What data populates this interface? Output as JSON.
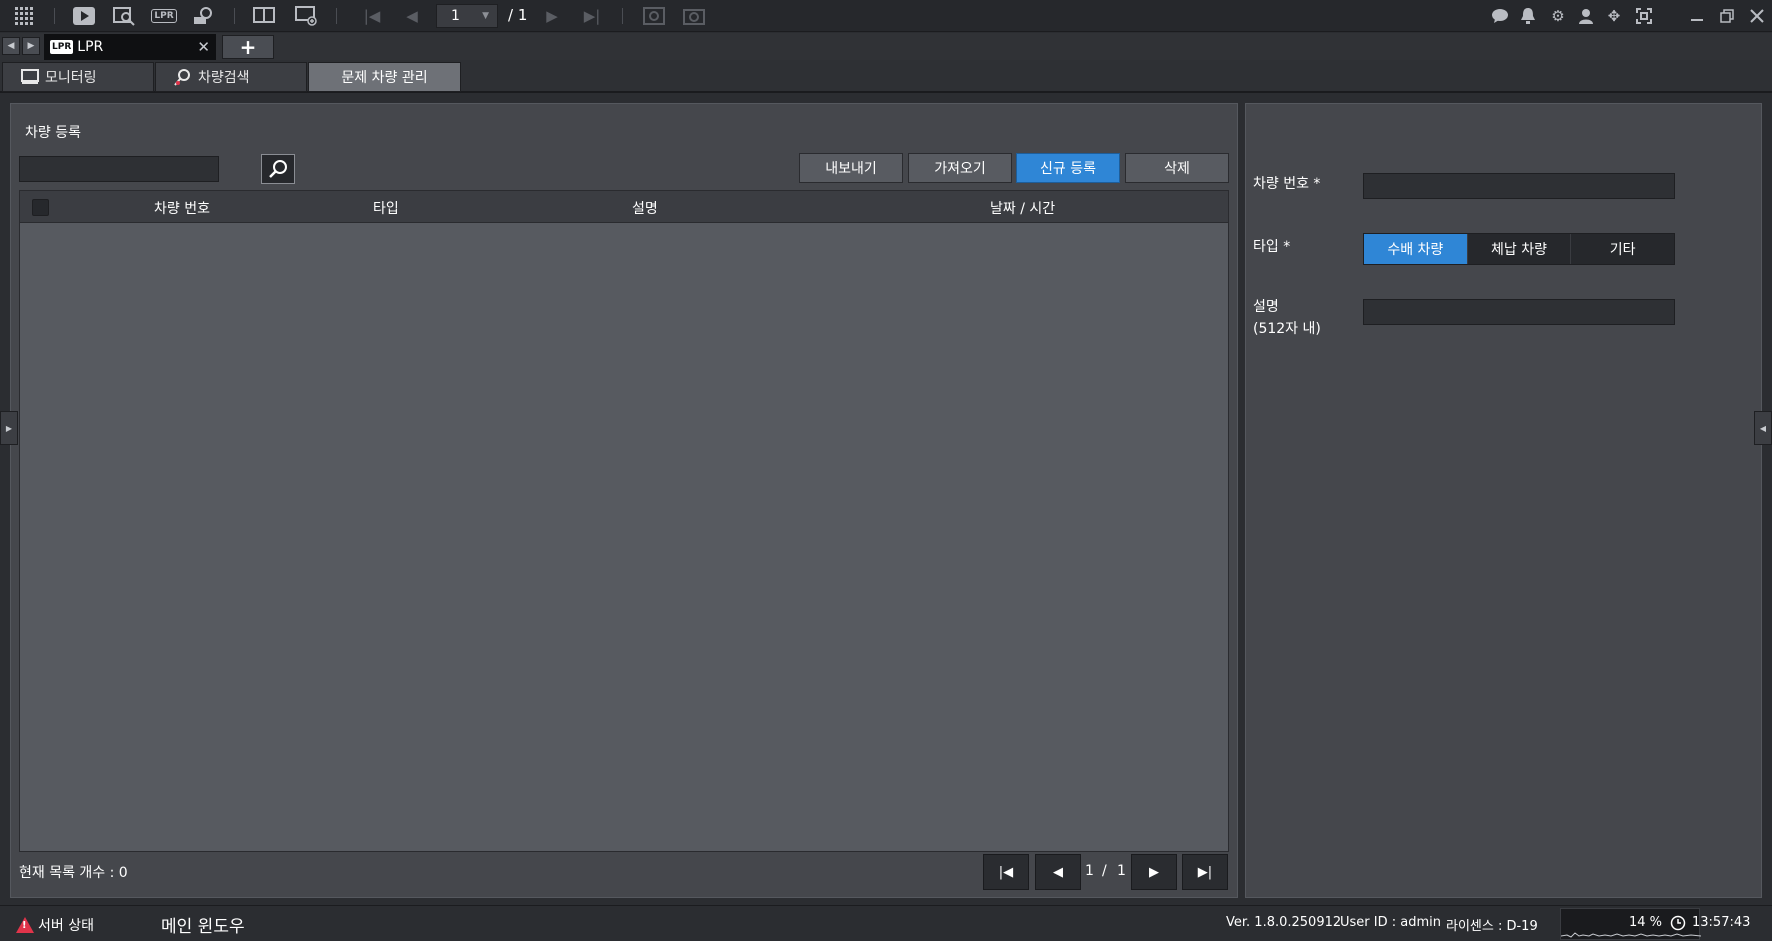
{
  "toolbar": {
    "page_current": "1",
    "page_total": "/ 1",
    "icons_left": [
      "grid-icon",
      "play-icon",
      "playback-search-icon",
      "lpr-icon",
      "camera-search-icon",
      "layout-icon",
      "add-display-icon"
    ],
    "icons_right": [
      "chat-icon",
      "alert-icon",
      "settings-icon",
      "user-icon",
      "move-icon",
      "fullscreen-icon",
      "minimize-icon",
      "restore-icon",
      "close-window-icon"
    ]
  },
  "tabs": {
    "lpr_logo": "LPR",
    "lpr_label": "LPR",
    "add_label": "+"
  },
  "subtabs": {
    "monitoring": "모니터링",
    "vehicle_search": "차량검색",
    "problem_vehicle": "문제 차량 관리"
  },
  "left": {
    "title": "차량 등록",
    "buttons": {
      "export": "내보내기",
      "import": "가져오기",
      "register": "신규 등록",
      "delete": "삭제"
    },
    "table": {
      "headers": {
        "plate": "차량 번호",
        "type": "타입",
        "desc": "설명",
        "datetime": "날짜 / 시간"
      },
      "rows": []
    },
    "count_text": "현재 목록 개수 : 0",
    "pagination": {
      "current": "1",
      "sep": "/",
      "total": "1"
    }
  },
  "right": {
    "plate_label": "차량 번호 *",
    "type_label": "타입 *",
    "type_options": [
      "수배 차량",
      "체납 차량",
      "기타"
    ],
    "type_selected": "수배 차량",
    "desc_label": "설명",
    "desc_hint": "(512자 내)"
  },
  "status": {
    "server_status": "서버 상태",
    "window_name": "메인 윈도우",
    "version": "Ver. 1.8.0.250912",
    "user": "User ID : admin",
    "license": "라이센스 : D-19",
    "cpu": "14 %",
    "time": "13:57:43"
  },
  "colors": {
    "accent": "#2f86d6",
    "warning": "#e0344a"
  }
}
